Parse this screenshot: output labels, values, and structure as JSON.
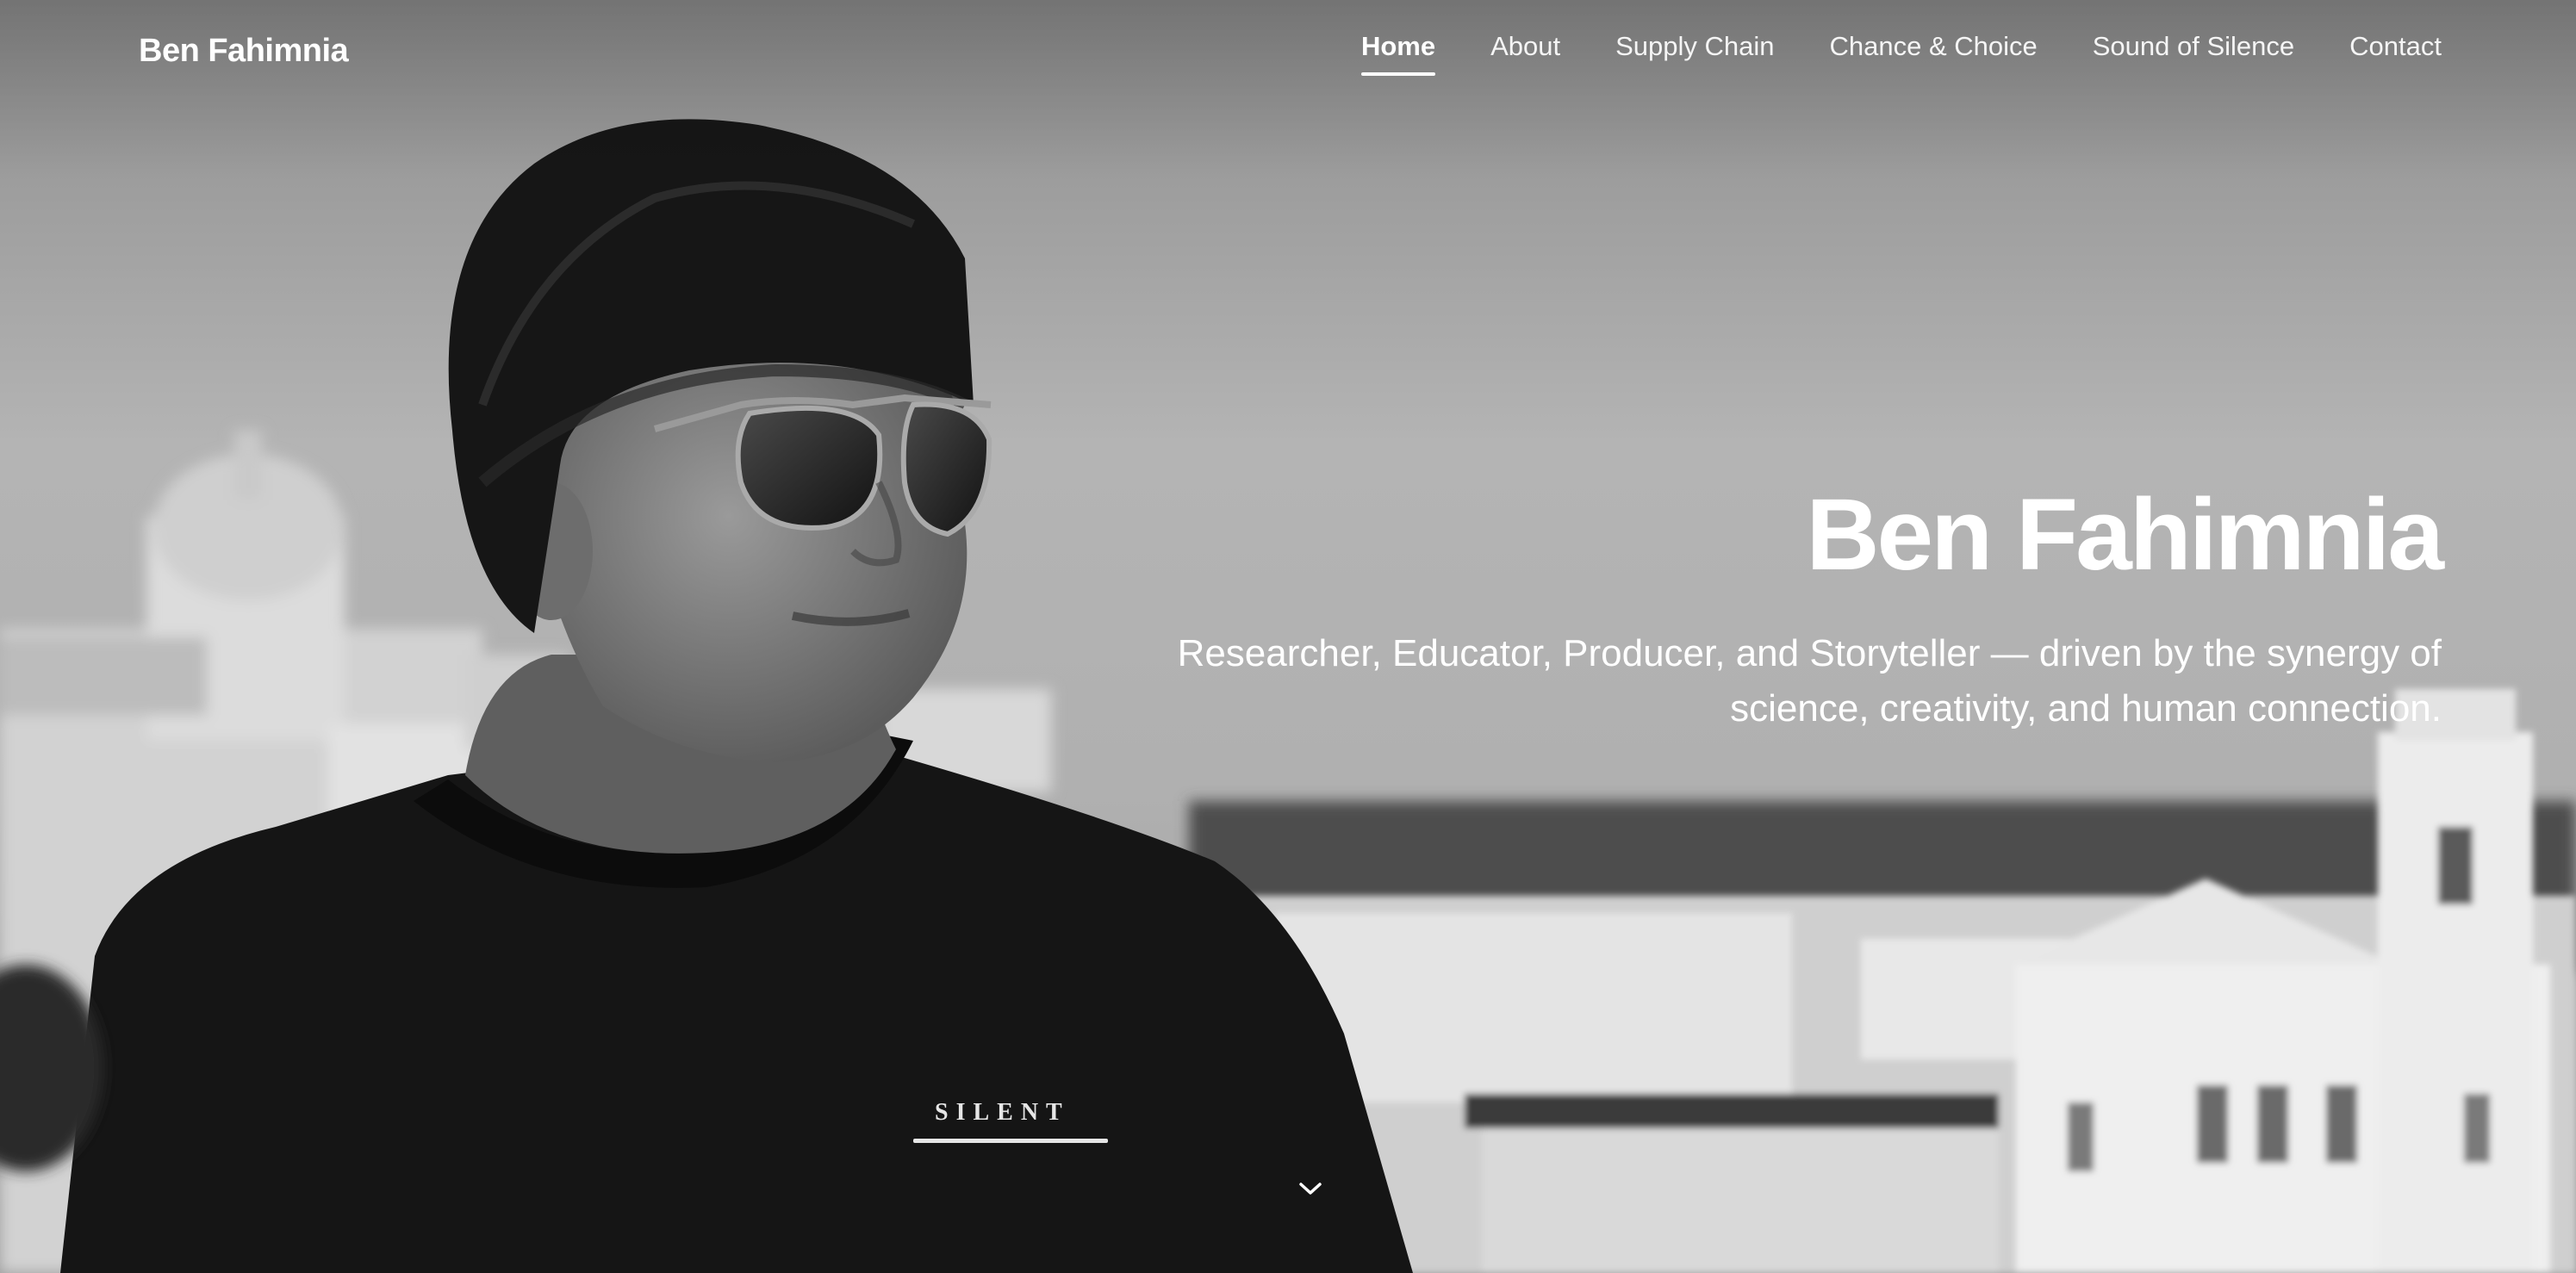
{
  "header": {
    "brand": "Ben Fahimnia"
  },
  "nav": {
    "items": [
      {
        "label": "Home",
        "active": true
      },
      {
        "label": "About",
        "active": false
      },
      {
        "label": "Supply Chain",
        "active": false
      },
      {
        "label": "Chance & Choice",
        "active": false
      },
      {
        "label": "Sound of Silence",
        "active": false
      },
      {
        "label": "Contact",
        "active": false
      }
    ]
  },
  "hero": {
    "title": "Ben Fahimnia",
    "tagline": "Researcher, Educator, Producer, and Storyteller — driven by the synergy of science, creativity, and human connection.",
    "shirt_text": "SILENT",
    "scroll_icon": "chevron-down-icon"
  },
  "colors": {
    "text": "#ffffff",
    "photo_tone": "grayscale"
  }
}
